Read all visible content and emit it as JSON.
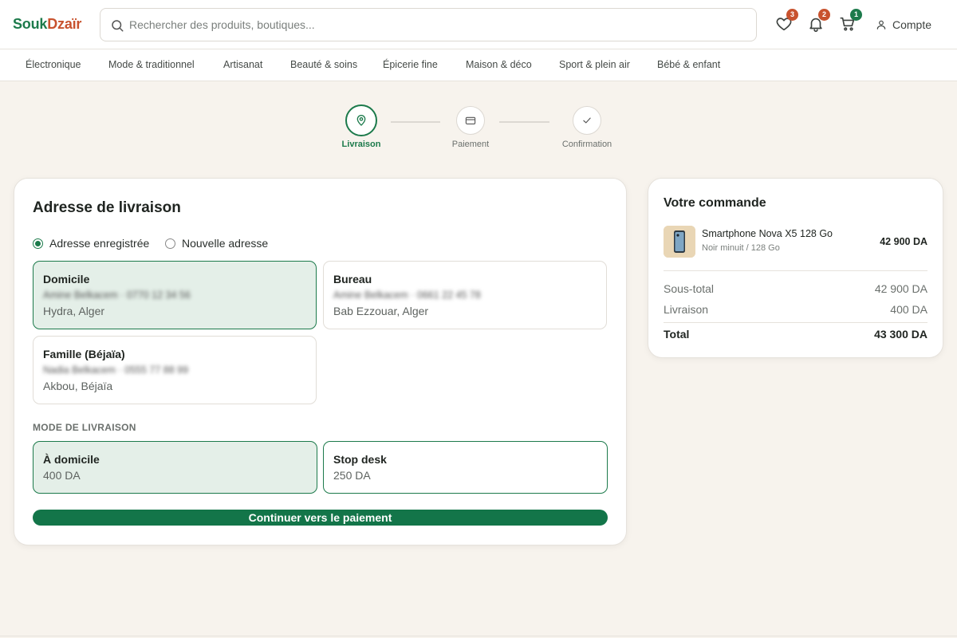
{
  "brand": {
    "part1": "Souk",
    "part2": "Dzaïr",
    "color1": "#1c7a4b",
    "color2": "#c8522e"
  },
  "search": {
    "placeholder": "Rechercher des produits, boutiques..."
  },
  "header": {
    "wishlist_count": "3",
    "notifications_count": "2",
    "cart_count": "1",
    "account_label": "Compte"
  },
  "categories": [
    "Électronique",
    "Mode & traditionnel",
    "Artisanat",
    "Beauté & soins",
    "Épicerie fine",
    "Maison & déco",
    "Sport & plein air",
    "Bébé & enfant"
  ],
  "stepper": {
    "steps": [
      {
        "label": "Livraison",
        "icon": "map-pin-icon",
        "state": "active"
      },
      {
        "label": "Paiement",
        "icon": "credit-card-icon",
        "state": "pending"
      },
      {
        "label": "Confirmation",
        "icon": "check-icon",
        "state": "pending"
      }
    ]
  },
  "address": {
    "title": "Adresse de livraison",
    "options": [
      "Adresse enregistrée",
      "Nouvelle adresse"
    ],
    "selected_option": "Adresse enregistrée",
    "cards": [
      {
        "name": "Domicile",
        "details": "Amine Belkacem · 0770 12 34 56",
        "city": "Hydra, Alger",
        "selected": true
      },
      {
        "name": "Bureau",
        "details": "Amine Belkacem · 0661 22 45 78",
        "city": "Bab Ezzouar, Alger",
        "selected": false
      },
      {
        "name": "Famille (Béjaïa)",
        "details": "Nadia Belkacem · 0555 77 88 99",
        "city": "Akbou, Béjaïa",
        "selected": false
      }
    ]
  },
  "delivery": {
    "label": "MODE DE LIVRAISON",
    "modes": [
      {
        "name": "À domicile",
        "price": "400 DA",
        "selected": true
      },
      {
        "name": "Stop desk",
        "price": "250 DA",
        "selected": false
      }
    ]
  },
  "cta": {
    "label": "Continuer vers le paiement"
  },
  "summary": {
    "title": "Votre commande",
    "item": {
      "name": "Smartphone Nova X5 128 Go",
      "variant": "Noir minuit / 128 Go",
      "price": "42 900 DA"
    },
    "subtotal_label": "Sous-total",
    "subtotal": "42 900 DA",
    "shipping_label": "Livraison",
    "shipping": "400 DA",
    "total_label": "Total",
    "total": "43 300 DA"
  },
  "colors": {
    "accent": "#1c7a4b",
    "badge_red": "#c8522e",
    "badge_green": "#1c7a4b",
    "background": "#f7f3ed"
  }
}
